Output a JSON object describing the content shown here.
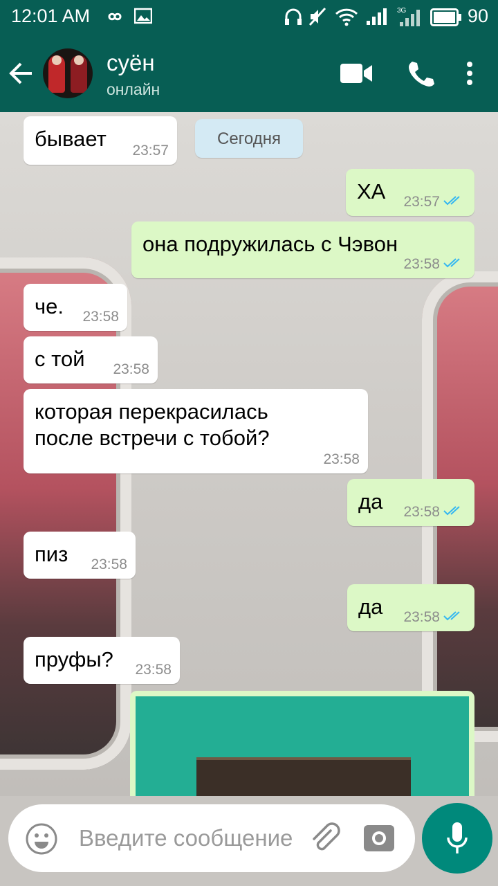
{
  "status_bar": {
    "time": "12:01 AM",
    "battery": "90",
    "network": "3G",
    "icons": [
      "infinity-icon",
      "image-icon",
      "headphones-icon",
      "mute-icon",
      "wifi-icon",
      "signal-icon",
      "signal-3g-icon",
      "battery-icon"
    ]
  },
  "header": {
    "contact_name": "суён",
    "contact_status": "онлайн",
    "icons": [
      "back-arrow-icon",
      "video-call-icon",
      "phone-icon",
      "more-vert-icon"
    ]
  },
  "chat": {
    "date_separator": "Сегодня",
    "messages": [
      {
        "direction": "in",
        "text": "бывает",
        "time": "23:57"
      },
      {
        "direction": "out",
        "text": "ХА",
        "time": "23:57",
        "status": "read"
      },
      {
        "direction": "out",
        "text": "она подружилась с Чэвон",
        "time": "23:58",
        "status": "read"
      },
      {
        "direction": "in",
        "text": "че.",
        "time": "23:58"
      },
      {
        "direction": "in",
        "text": "с той",
        "time": "23:58"
      },
      {
        "direction": "in",
        "text": "которая перекрасилась\nпосле встречи с тобой?",
        "time": "23:58"
      },
      {
        "direction": "out",
        "text": "да",
        "time": "23:58",
        "status": "read"
      },
      {
        "direction": "in",
        "text": "пиз",
        "time": "23:58"
      },
      {
        "direction": "out",
        "text": "да",
        "time": "23:58",
        "status": "read"
      },
      {
        "direction": "in",
        "text": "пруфы?",
        "time": "23:58"
      },
      {
        "direction": "out",
        "type": "image",
        "text": "",
        "time": ""
      }
    ],
    "colors": {
      "incoming": "#ffffff",
      "outgoing": "#dcf8c6",
      "read_ticks": "#34b7f1",
      "header": "#075e54"
    }
  },
  "input": {
    "placeholder": "Введите сообщение",
    "icons": [
      "emoji-icon",
      "attach-icon",
      "camera-icon",
      "mic-icon"
    ]
  }
}
